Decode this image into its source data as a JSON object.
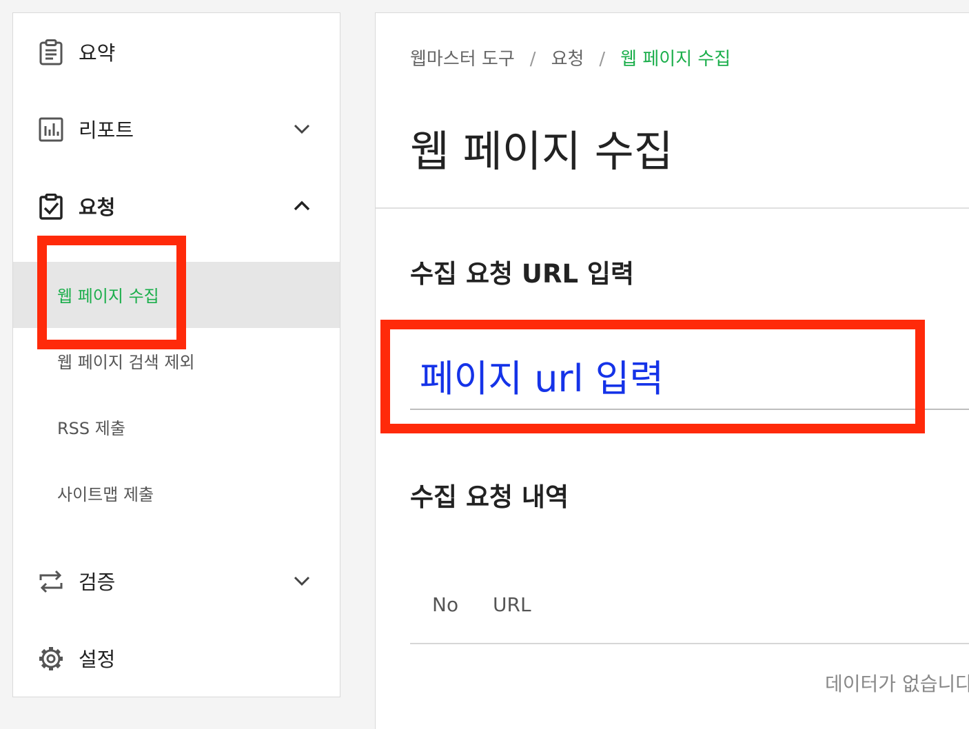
{
  "sidebar": {
    "items": [
      {
        "label": "요약",
        "icon": "clipboard-list-icon"
      },
      {
        "label": "리포트",
        "icon": "bar-chart-icon",
        "expandable": true,
        "expanded": false
      },
      {
        "label": "요청",
        "icon": "clipboard-check-icon",
        "expandable": true,
        "expanded": true,
        "children": [
          {
            "label": "웹 페이지 수집",
            "active": true
          },
          {
            "label": "웹 페이지 검색 제외"
          },
          {
            "label": "RSS 제출"
          },
          {
            "label": "사이트맵 제출"
          }
        ]
      },
      {
        "label": "검증",
        "icon": "sync-arrows-icon",
        "expandable": true,
        "expanded": false
      },
      {
        "label": "설정",
        "icon": "gear-icon"
      }
    ]
  },
  "breadcrumb": {
    "level1": "웹마스터 도구",
    "separator": "/",
    "level2": "요청",
    "current": "웹 페이지 수집"
  },
  "main": {
    "title": "웹 페이지 수집",
    "url_section_title": "수집 요청 URL 입력",
    "url_input_placeholder": "페이지 url 입력",
    "url_input_value": "",
    "history_section_title": "수집 요청 내역",
    "table": {
      "columns": [
        "No",
        "URL"
      ],
      "rows": [],
      "empty_message": "데이터가 없습니다"
    }
  },
  "colors": {
    "accent_green": "#1bae4b",
    "highlight_red": "#ff2a0a",
    "placeholder_blue": "#1533e8"
  }
}
